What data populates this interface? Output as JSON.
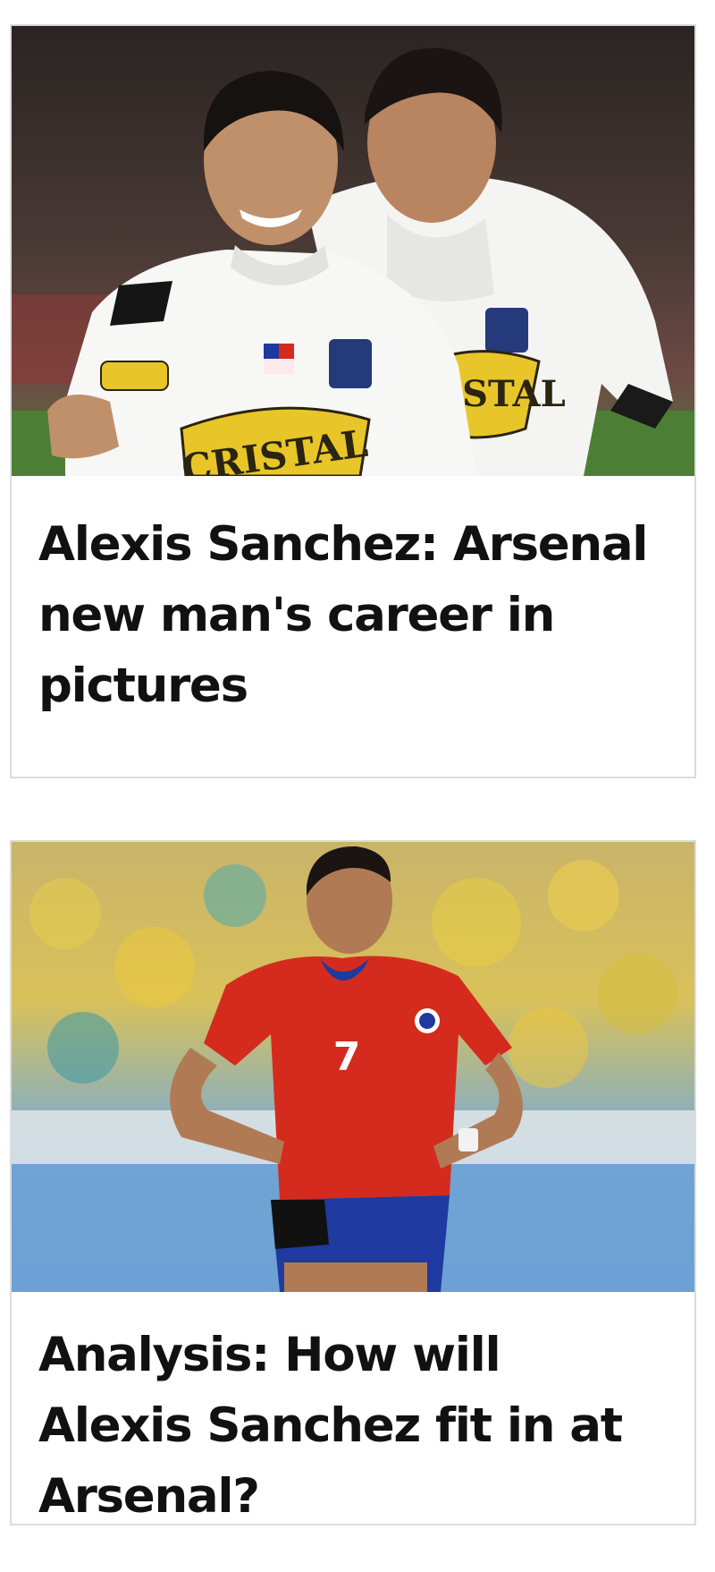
{
  "articles": [
    {
      "headline": "Alexis Sanchez: Arsenal new man's career in pictures",
      "image_alt": "Alexis Sanchez celebrating with teammate in white Colo-Colo shirt",
      "shirt_sponsor": "CRISTAL"
    },
    {
      "headline": "Analysis: How will Alexis Sanchez fit in at Arsenal?",
      "image_alt": "Alexis Sanchez in red Chile shirt number 7",
      "shirt_number": "7"
    }
  ],
  "colors": {
    "card_border": "#dcdcdc",
    "headline_text": "#111111",
    "chile_red": "#d42b1e",
    "chile_blue": "#1e3a9e",
    "sponsor_yellow": "#e8c62a"
  }
}
